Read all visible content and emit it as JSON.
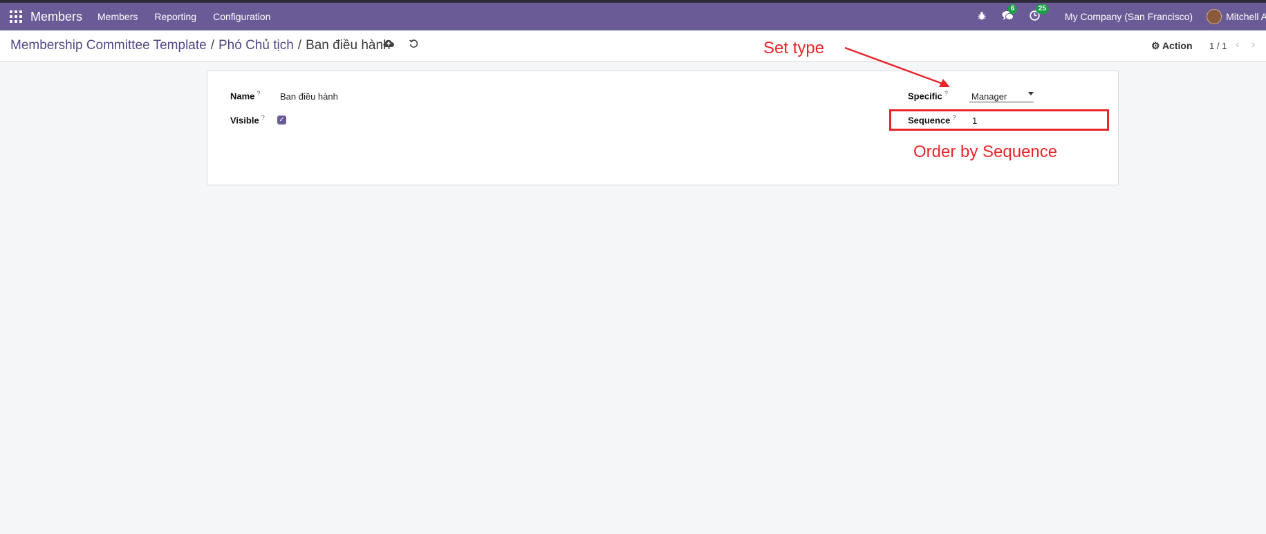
{
  "topbar": {
    "app_name": "Members",
    "menu": [
      "Members",
      "Reporting",
      "Configuration"
    ],
    "messages_count": "6",
    "activities_count": "25",
    "company": "My Company (San Francisco)",
    "user": "Mitchell A",
    "accent_color": "#6a5b96"
  },
  "breadcrumb": {
    "items": [
      "Membership Committee Template",
      "Phó Chủ tịch"
    ],
    "current": "Ban điều hành",
    "separator": "/"
  },
  "control": {
    "action_label": "Action",
    "pager": "1 / 1"
  },
  "form": {
    "name_label": "Name",
    "name_value": "Ban điều hành",
    "visible_label": "Visible",
    "visible_checked": true,
    "specific_label": "Specific",
    "specific_value": "Manager",
    "sequence_label": "Sequence",
    "sequence_value": "1",
    "help_mark": "?"
  },
  "annotations": {
    "set_type": "Set type",
    "order_by_sequence": "Order by Sequence",
    "color": "#e8262a"
  }
}
